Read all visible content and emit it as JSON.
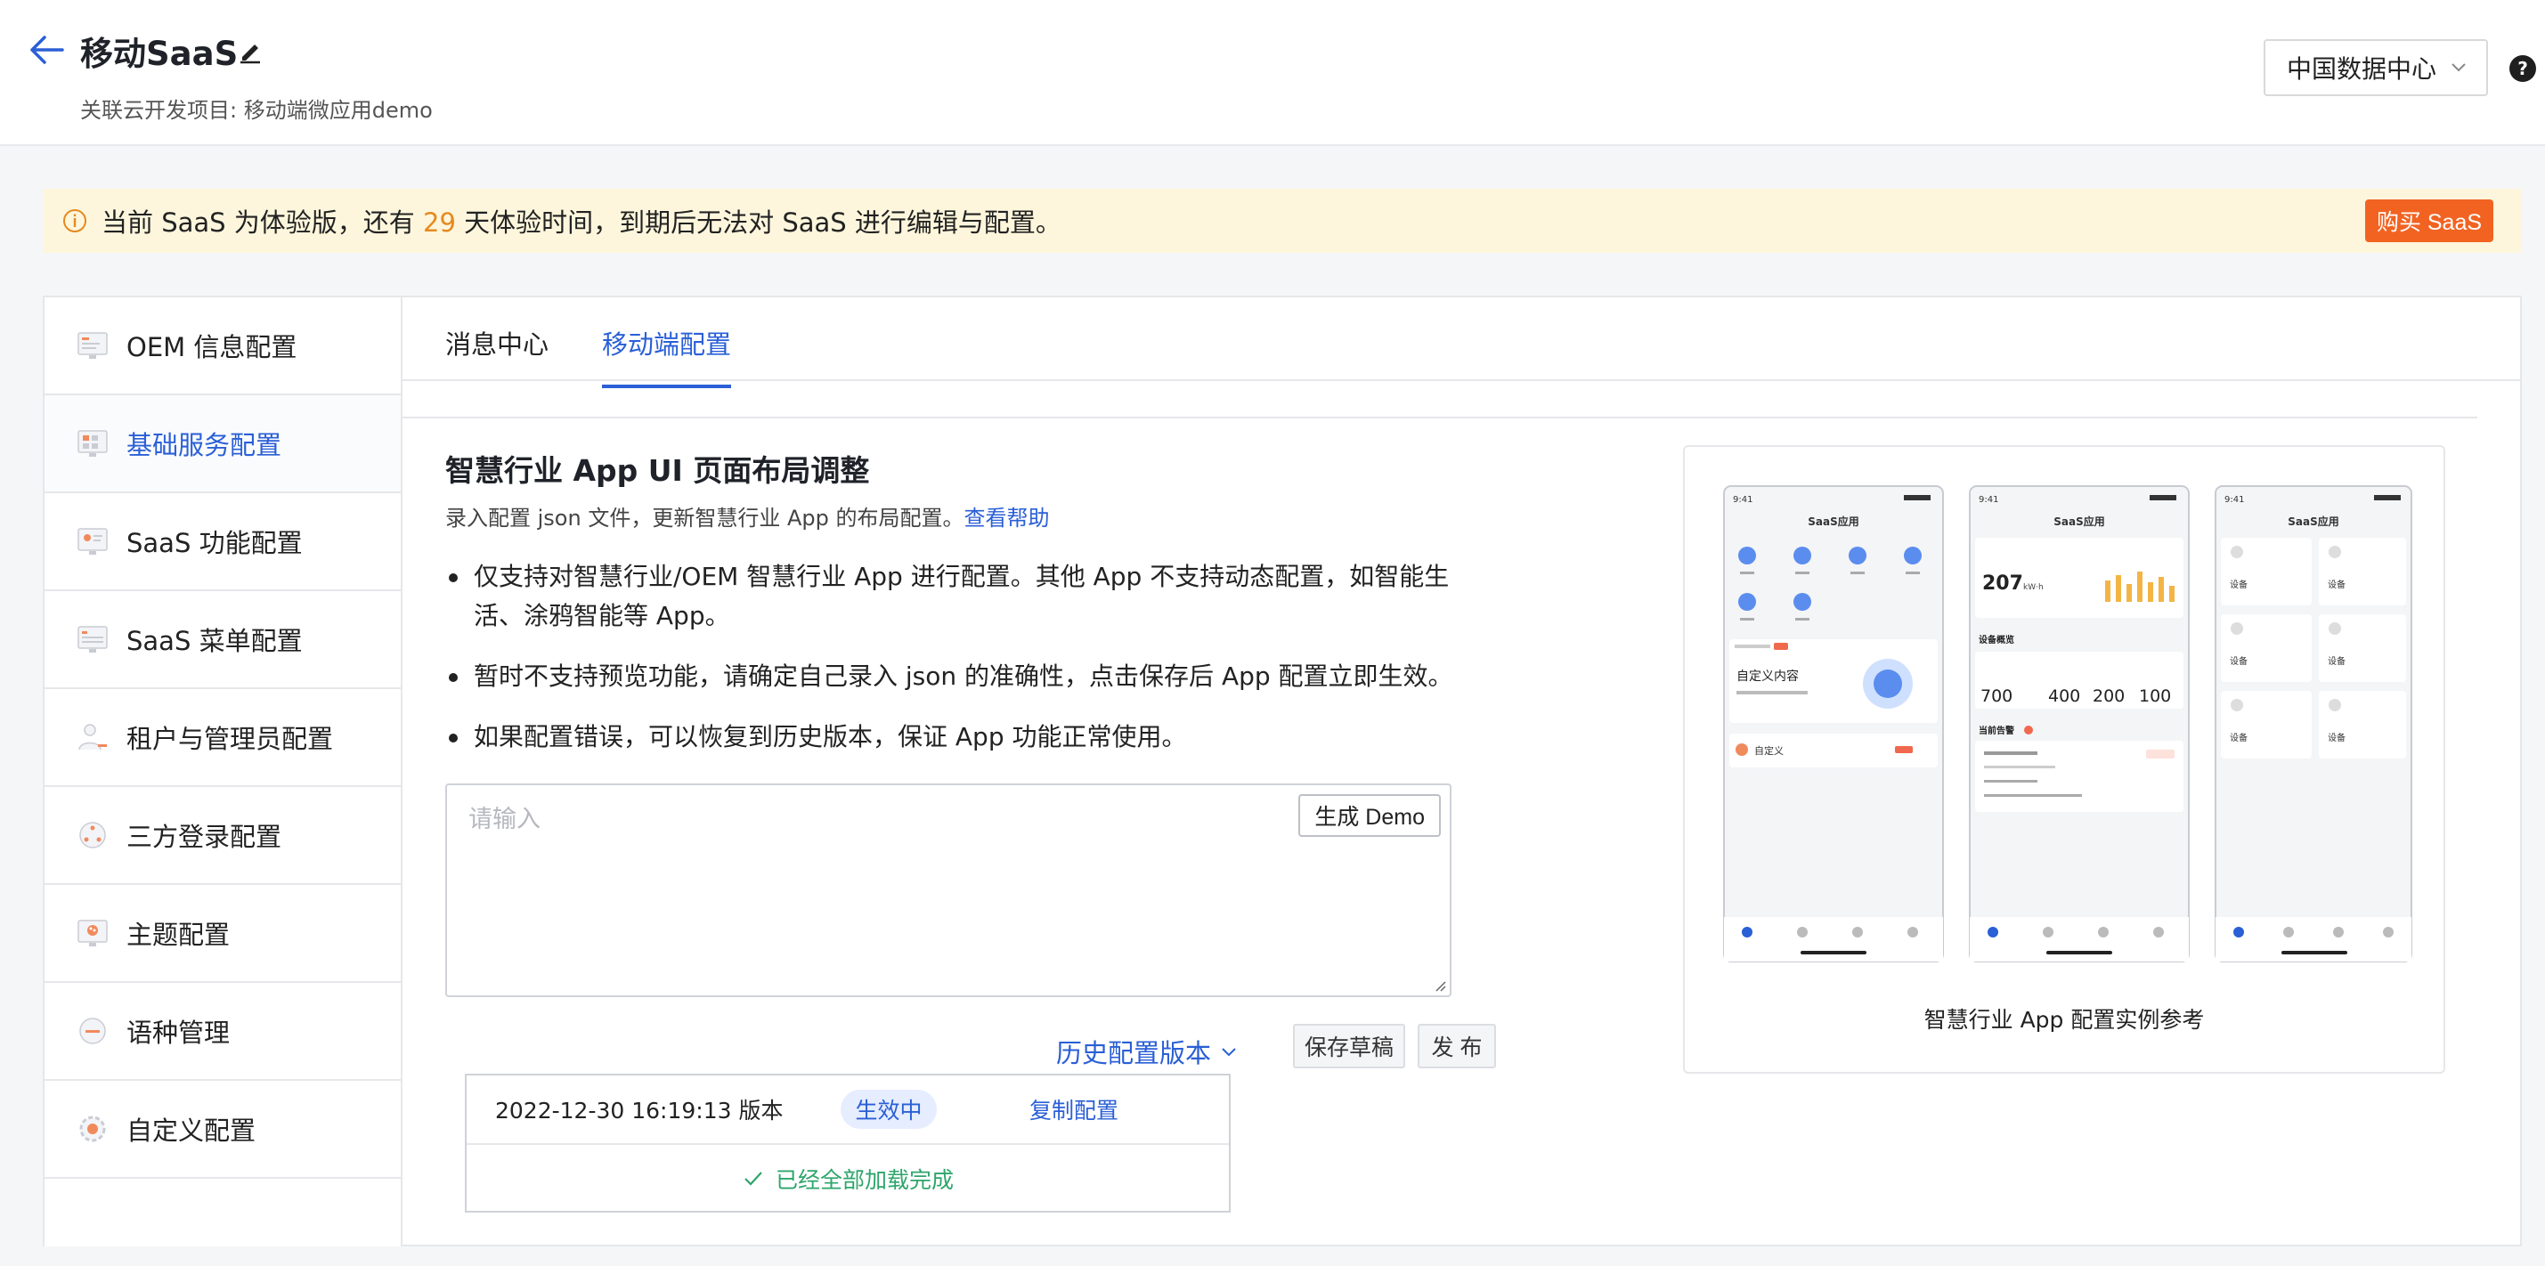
{
  "header": {
    "title": "移动SaaS",
    "subtitle": "关联云开发项目: 移动端微应用demo",
    "region": "中国数据中心",
    "help": "?"
  },
  "notice": {
    "prefix": "当前 SaaS 为体验版，还有 ",
    "days": "29",
    "suffix": " 天体验时间，到期后无法对 SaaS 进行编辑与配置。",
    "buy_label": "购买 SaaS"
  },
  "sidebar": {
    "items": [
      {
        "label": "OEM 信息配置",
        "icon": "oem-info-icon"
      },
      {
        "label": "基础服务配置",
        "icon": "basic-service-icon",
        "active": true
      },
      {
        "label": "SaaS 功能配置",
        "icon": "saas-function-icon"
      },
      {
        "label": "SaaS 菜单配置",
        "icon": "saas-menu-icon"
      },
      {
        "label": "租户与管理员配置",
        "icon": "tenant-admin-icon"
      },
      {
        "label": "三方登录配置",
        "icon": "third-party-login-icon"
      },
      {
        "label": "主题配置",
        "icon": "theme-icon"
      },
      {
        "label": "语种管理",
        "icon": "language-icon"
      },
      {
        "label": "自定义配置",
        "icon": "custom-config-icon"
      }
    ]
  },
  "tabs": {
    "message_center": "消息中心",
    "mobile_config": "移动端配置"
  },
  "section": {
    "title": "智慧行业 App UI 页面布局调整",
    "desc": "录入配置 json 文件，更新智慧行业 App 的布局配置。",
    "help_link": "查看帮助",
    "bullets": [
      "仅支持对智慧行业/OEM 智慧行业 App 进行配置。其他 App 不支持动态配置，如智能生活、涂鸦智能等 App。",
      "暂时不支持预览功能，请确定自己录入 json 的准确性，点击保存后 App 配置立即生效。",
      "如果配置错误，可以恢复到历史版本，保证 App 功能正常使用。"
    ]
  },
  "editor": {
    "placeholder": "请输入",
    "generate_demo": "生成 Demo"
  },
  "actions": {
    "history": "历史配置版本",
    "save_draft": "保存草稿",
    "publish": "发 布"
  },
  "history": {
    "version": "2022-12-30 16:19:13 版本",
    "status": "生效中",
    "copy": "复制配置",
    "loaded": "已经全部加载完成"
  },
  "preview": {
    "caption": "智慧行业 App 配置实例参考",
    "time": "9:41",
    "app_title": "SaaS应用",
    "custom_content": "自定义内容",
    "custom": "自定义",
    "power_value": "207",
    "power_unit": "kW·h",
    "device_overview": "设备概览",
    "device_total": "700",
    "device_normal": "400",
    "device_fault": "200",
    "device_offline": "100",
    "current_alarm": "当前告警",
    "device_label": "设备"
  },
  "colors": {
    "accent": "#2a5fd6",
    "warning": "#e58a1f",
    "buy": "#f26322",
    "notice_bg": "#fdf6dc",
    "success": "#2ea56b"
  }
}
